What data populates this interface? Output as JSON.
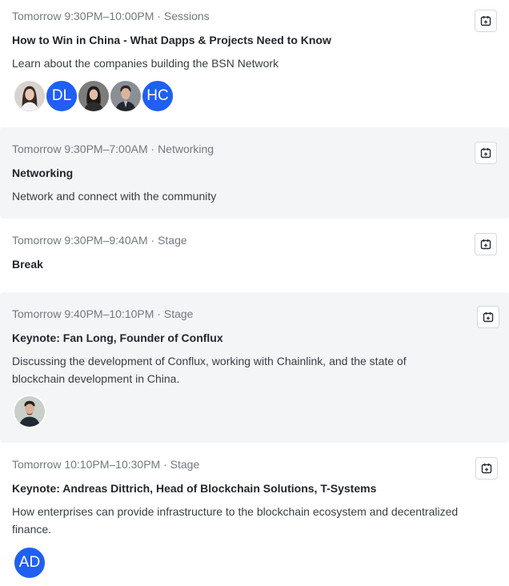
{
  "colors": {
    "accent": "#1f5ff2",
    "shaded_card": "#f4f5f7",
    "meta_text": "#737881"
  },
  "events": [
    {
      "meta": "Tomorrow 9:30PM–10:00PM · Sessions",
      "title": "How to Win in China - What Dapps & Projects Need to Know",
      "description": "Learn about the companies building the BSN Network",
      "calendar_icon": "calendar-add-icon",
      "speakers": [
        {
          "type": "photo",
          "icon": "woman-portrait"
        },
        {
          "type": "initials",
          "initials": "DL"
        },
        {
          "type": "photo",
          "icon": "woman-portrait"
        },
        {
          "type": "photo",
          "icon": "man-in-suit-portrait"
        },
        {
          "type": "initials",
          "initials": "HC"
        }
      ]
    },
    {
      "meta": "Tomorrow 9:30PM–7:00AM · Networking",
      "title": "Networking",
      "description": "Network and connect with the community",
      "calendar_icon": "calendar-add-icon"
    },
    {
      "meta": "Tomorrow 9:30PM–9:40AM · Stage",
      "title": "Break",
      "calendar_icon": "calendar-add-icon"
    },
    {
      "meta": "Tomorrow 9:40PM–10:10PM · Stage",
      "title": "Keynote: Fan Long, Founder of Conflux",
      "description": "Discussing the development of Conflux, working with Chainlink, and the state of blockchain development in China.",
      "calendar_icon": "calendar-add-icon",
      "speakers": [
        {
          "type": "photo",
          "icon": "man-portrait"
        }
      ]
    },
    {
      "meta": "Tomorrow 10:10PM–10:30PM · Stage",
      "title": "Keynote: Andreas Dittrich, Head of Blockchain Solutions, T-Systems",
      "description": "How enterprises can provide infrastructure to the blockchain ecosystem and decentralized finance.",
      "calendar_icon": "calendar-add-icon",
      "speakers": [
        {
          "type": "initials",
          "initials": "AD"
        }
      ]
    }
  ]
}
